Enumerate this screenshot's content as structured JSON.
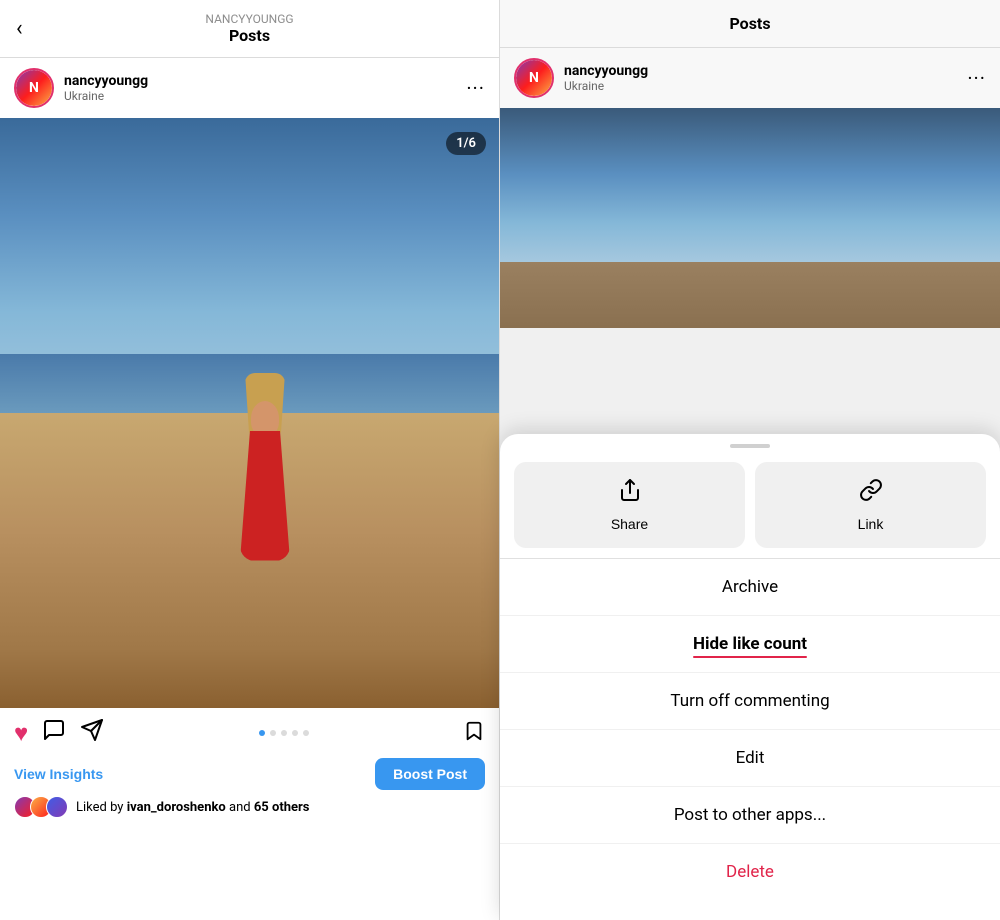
{
  "left": {
    "header": {
      "back_icon": "‹",
      "username_label": "NANCYYOUNGG",
      "title": "Posts"
    },
    "post": {
      "username": "nancyyoungg",
      "location": "Ukraine",
      "counter": "1/6",
      "view_insights": "View Insights",
      "boost_post": "Boost Post",
      "likes_text_prefix": "Liked by",
      "likes_user": "ivan_doroshenko",
      "likes_and": "and",
      "likes_count": "65 others"
    }
  },
  "right": {
    "header": {
      "title": "Posts"
    },
    "post": {
      "username": "nancyyoungg",
      "location": "Ukraine"
    },
    "sheet": {
      "handle_aria": "drag handle",
      "share_label": "Share",
      "link_label": "Link",
      "menu_items": [
        {
          "id": "archive",
          "label": "Archive",
          "active": false,
          "delete": false
        },
        {
          "id": "hide-like-count",
          "label": "Hide like count",
          "active": true,
          "delete": false
        },
        {
          "id": "turn-off-commenting",
          "label": "Turn off commenting",
          "active": false,
          "delete": false
        },
        {
          "id": "edit",
          "label": "Edit",
          "active": false,
          "delete": false
        },
        {
          "id": "post-to-other-apps",
          "label": "Post to other apps...",
          "active": false,
          "delete": false
        },
        {
          "id": "delete",
          "label": "Delete",
          "active": false,
          "delete": true
        }
      ]
    }
  }
}
